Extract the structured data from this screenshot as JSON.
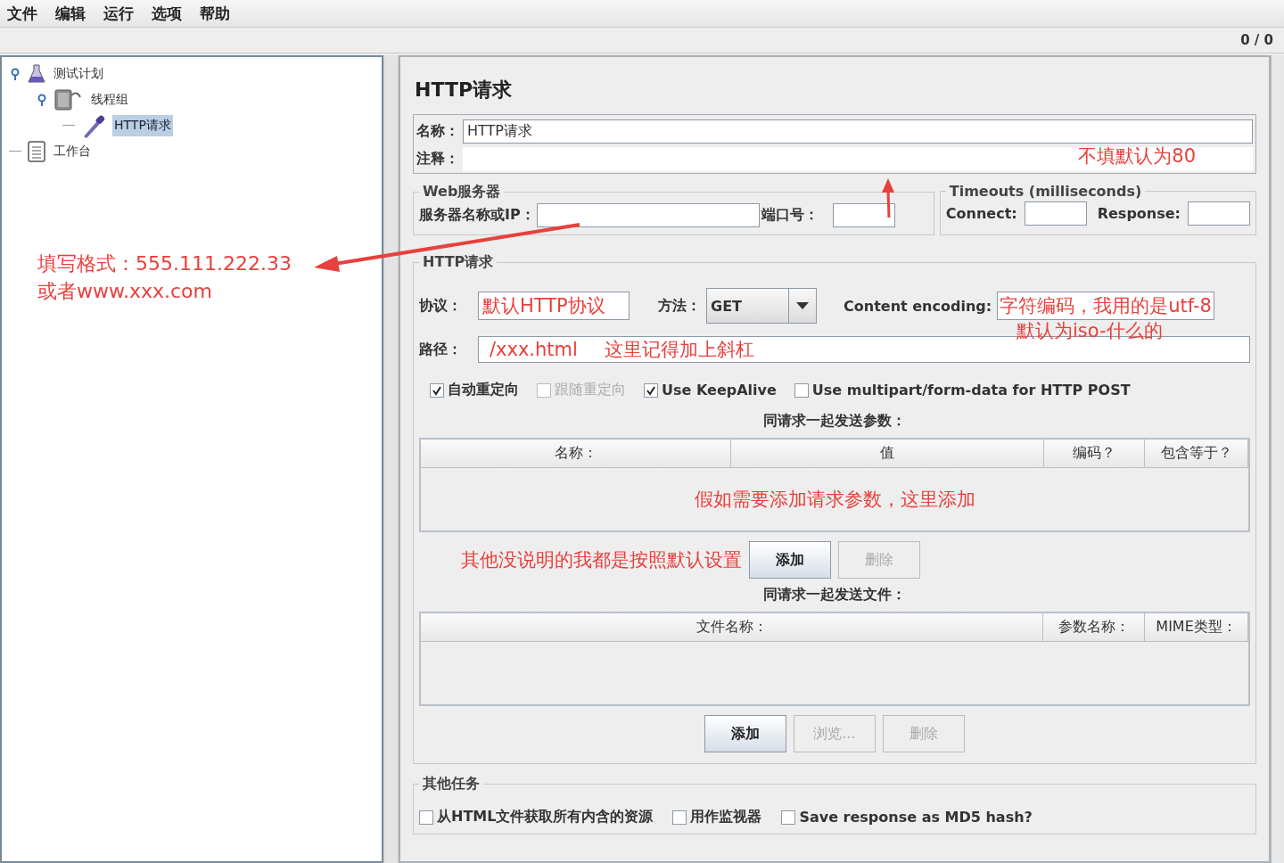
{
  "menu": [
    "文件",
    "编辑",
    "运行",
    "选项",
    "帮助"
  ],
  "toolbar": {
    "counter": "0 / 0"
  },
  "tree": [
    {
      "label": "测试计划",
      "kind": "flask",
      "expanded": true,
      "selected": false,
      "children": [
        {
          "label": "线程组",
          "kind": "spool",
          "expanded": true,
          "selected": false,
          "children": [
            {
              "label": "HTTP请求",
              "kind": "pipette",
              "selected": true
            }
          ]
        }
      ]
    },
    {
      "label": "工作台",
      "kind": "clipboard",
      "selected": false
    }
  ],
  "panel": {
    "title": "HTTP请求",
    "name_label": "名称：",
    "name_value": "HTTP请求",
    "comment_label": "注释：",
    "web_server": {
      "legend": "Web服务器",
      "server_label": "服务器名称或IP：",
      "port_label": "端口号："
    },
    "timeouts": {
      "legend": "Timeouts (milliseconds)",
      "connect_label": "Connect:",
      "response_label": "Response:"
    },
    "request": {
      "legend": "HTTP请求",
      "protocol_label": "协议：",
      "protocol_value": "默认HTTP协议",
      "method_label": "方法：",
      "method_value": "GET",
      "encoding_label": "Content encoding:",
      "encoding_value": "字符编码，我用的是utf-8",
      "path_label": "路径：",
      "path_value": "/xxx.html",
      "options": [
        {
          "label": "自动重定向",
          "checked": true,
          "disabled": false
        },
        {
          "label": "跟随重定向",
          "checked": false,
          "disabled": true
        },
        {
          "label": "Use KeepAlive",
          "checked": true,
          "disabled": false
        },
        {
          "label": "Use multipart/form-data for HTTP POST",
          "checked": false,
          "disabled": false
        }
      ],
      "params": {
        "caption": "同请求一起发送参数：",
        "columns": [
          "名称：",
          "值",
          "编码？",
          "包含等于？"
        ],
        "buttons": [
          {
            "label": "添加",
            "disabled": false
          },
          {
            "label": "删除",
            "disabled": true
          }
        ]
      },
      "files": {
        "caption": "同请求一起发送文件：",
        "columns": [
          "文件名称：",
          "参数名称：",
          "MIME类型："
        ],
        "buttons": [
          {
            "label": "添加",
            "disabled": false
          },
          {
            "label": "浏览...",
            "disabled": true
          },
          {
            "label": "删除",
            "disabled": true
          }
        ]
      }
    },
    "other_tasks": {
      "legend": "其他任务",
      "options": [
        {
          "label": "从HTML文件获取所有内含的资源",
          "checked": false
        },
        {
          "label": "用作监视器",
          "checked": false
        },
        {
          "label": "Save response as MD5 hash?",
          "checked": false
        }
      ]
    }
  },
  "annotations": {
    "port_note": "不填默认为80",
    "server_note": [
      "填写格式：555.111.222.33",
      "或者www.xxx.com"
    ],
    "encoding_note": "默认为iso-什么的",
    "path_note": "这里记得加上斜杠",
    "params_note": "假如需要添加请求参数，这里添加",
    "buttons_note": "其他没说明的我都是按照默认设置"
  }
}
